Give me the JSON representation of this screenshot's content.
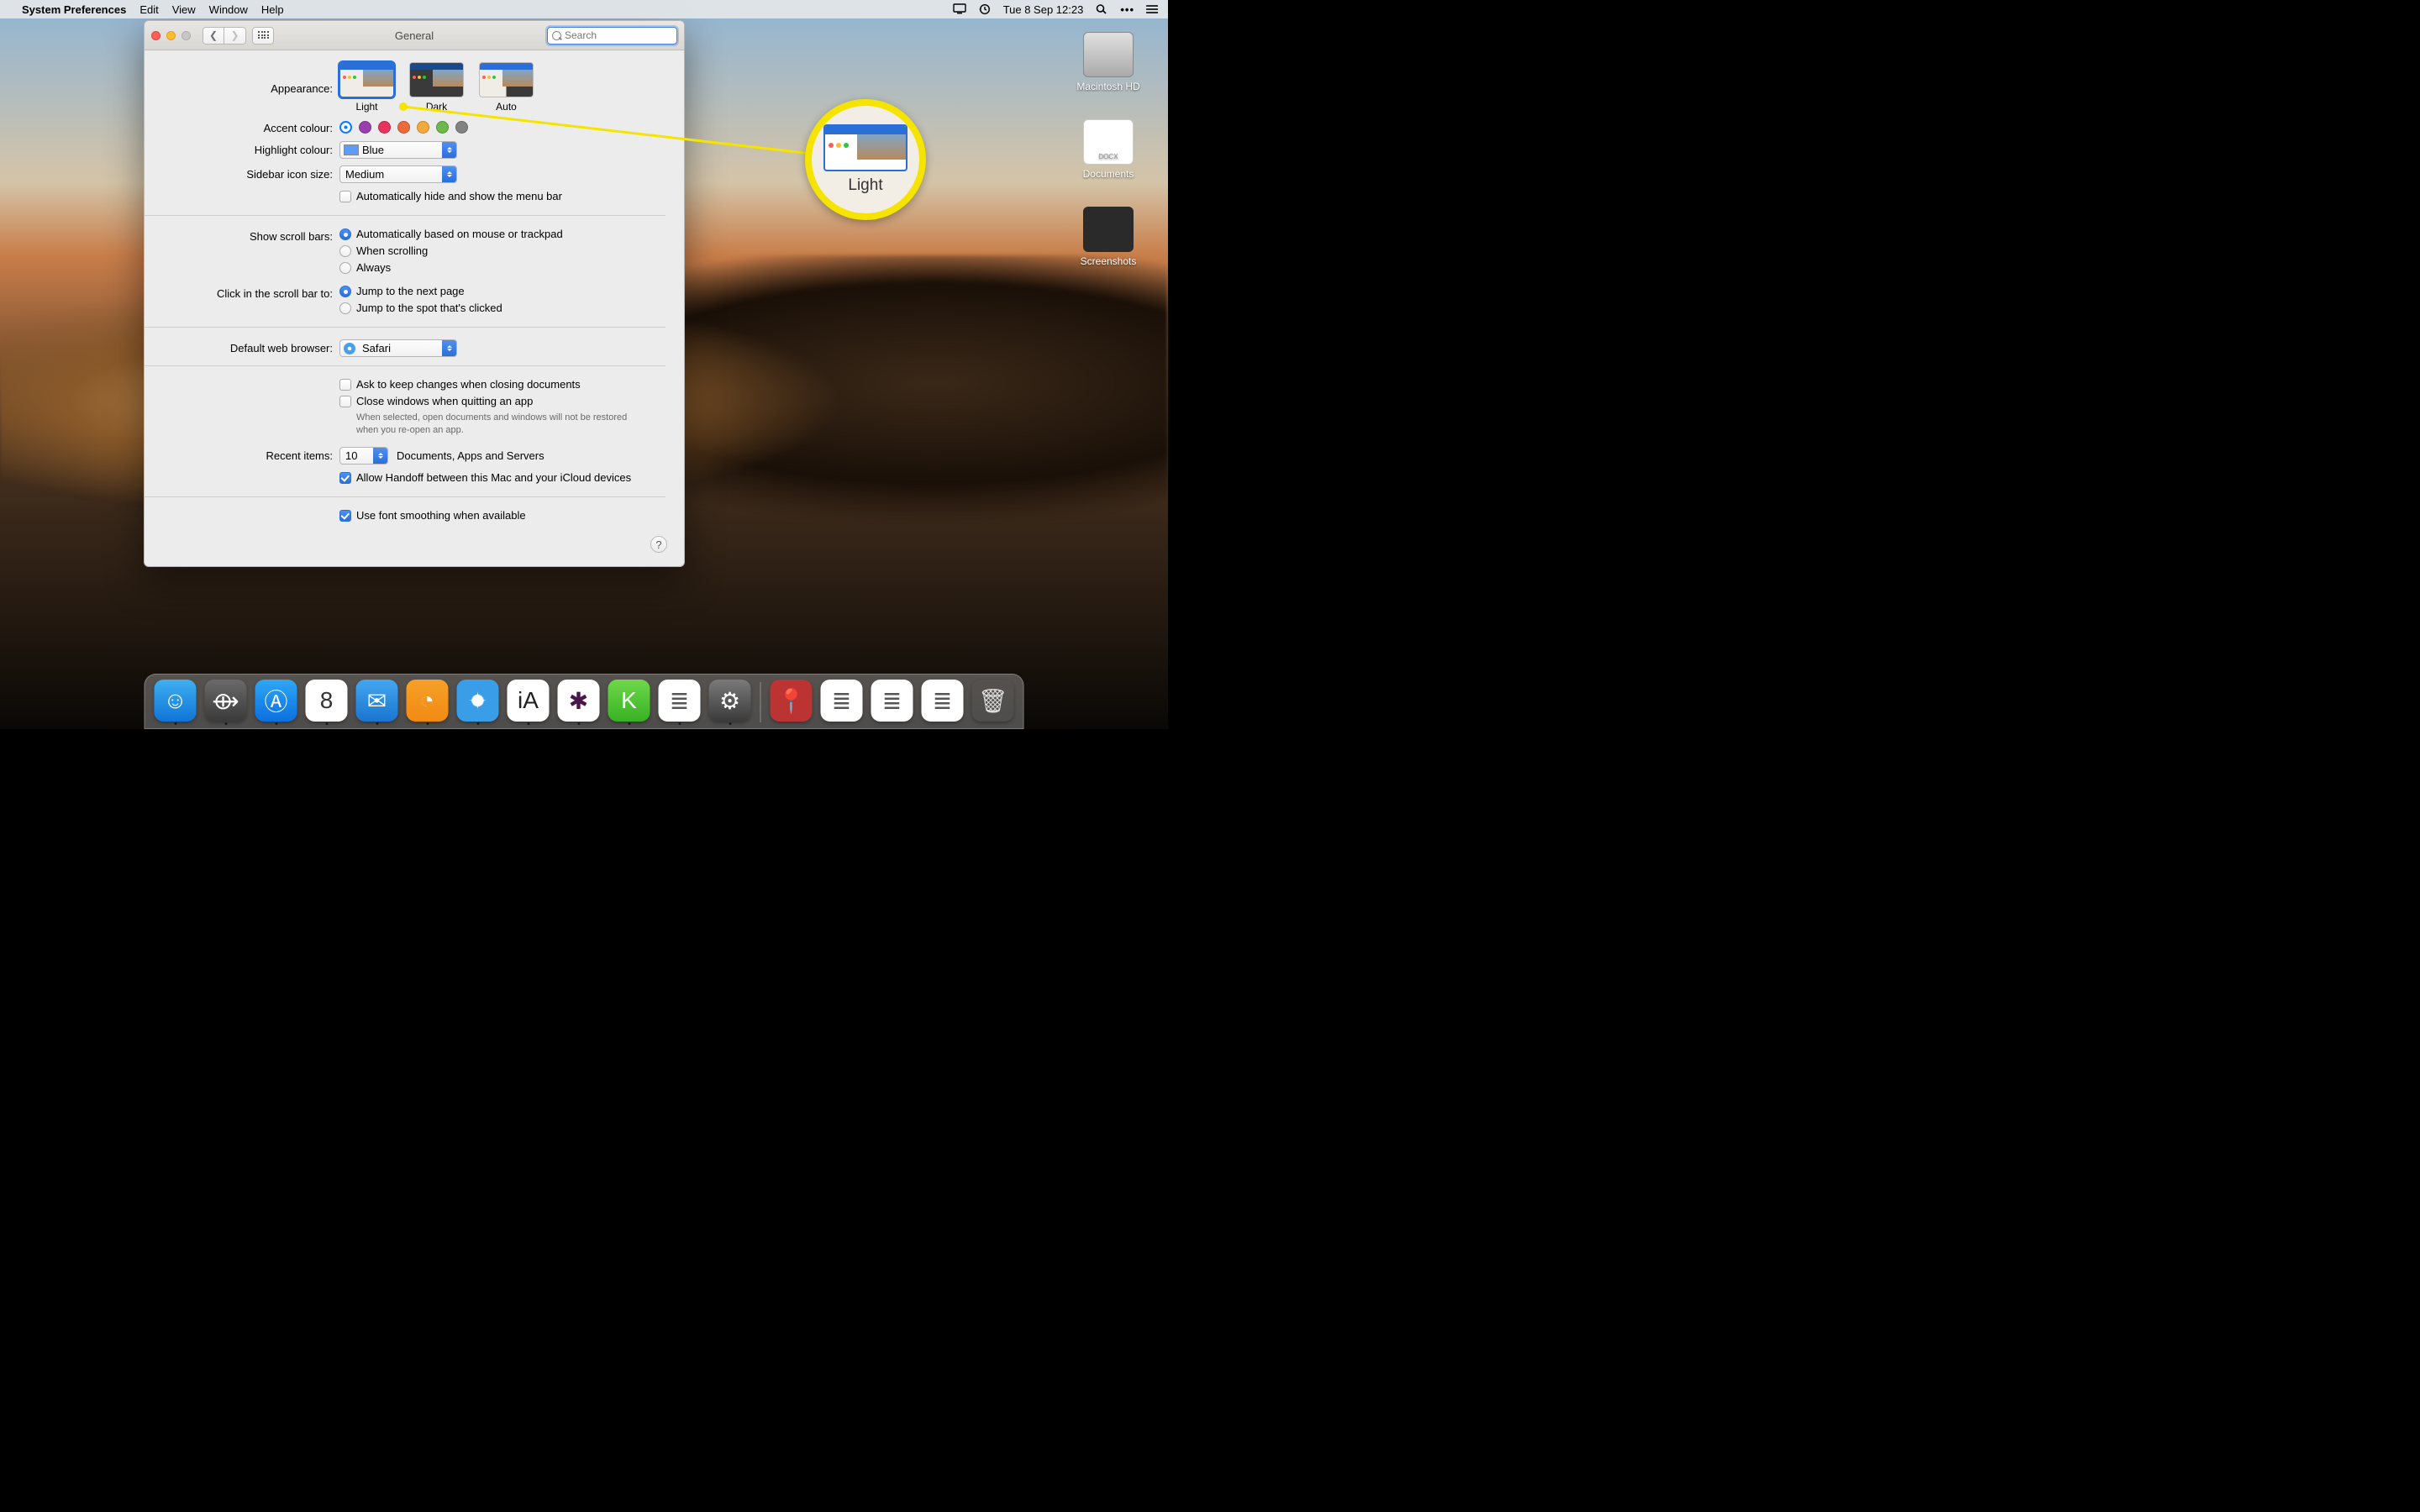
{
  "menubar": {
    "app": "System Preferences",
    "items": [
      "Edit",
      "View",
      "Window",
      "Help"
    ],
    "datetime": "Tue 8 Sep  12:23"
  },
  "desktop_icons": [
    {
      "name": "Macintosh HD",
      "kind": "hd"
    },
    {
      "name": "Documents",
      "kind": "folder",
      "badge": "DOCX"
    },
    {
      "name": "Screenshots",
      "kind": "shots"
    }
  ],
  "window": {
    "title": "General",
    "search_placeholder": "Search"
  },
  "general": {
    "appearance_label": "Appearance:",
    "appearance": [
      {
        "label": "Light",
        "selected": true,
        "kind": "light"
      },
      {
        "label": "Dark",
        "selected": false,
        "kind": "dark"
      },
      {
        "label": "Auto",
        "selected": false,
        "kind": "auto"
      }
    ],
    "accent_label": "Accent colour:",
    "accent_colors": [
      "#0a7aff",
      "#9a3ead",
      "#e7345a",
      "#ef6a3b",
      "#f3a93b",
      "#6cb84b",
      "#828282"
    ],
    "accent_selected_index": 0,
    "highlight_label": "Highlight colour:",
    "highlight_value": "Blue",
    "sidebar_label": "Sidebar icon size:",
    "sidebar_value": "Medium",
    "autohide_label": "Automatically hide and show the menu bar",
    "scroll_label": "Show scroll bars:",
    "scroll_opts": [
      {
        "label": "Automatically based on mouse or trackpad",
        "on": true
      },
      {
        "label": "When scrolling",
        "on": false
      },
      {
        "label": "Always",
        "on": false
      }
    ],
    "click_label": "Click in the scroll bar to:",
    "click_opts": [
      {
        "label": "Jump to the next page",
        "on": true
      },
      {
        "label": "Jump to the spot that's clicked",
        "on": false
      }
    ],
    "browser_label": "Default web browser:",
    "browser_value": "Safari",
    "ask_keep_label": "Ask to keep changes when closing documents",
    "close_windows_label": "Close windows when quitting an app",
    "close_windows_help": "When selected, open documents and windows will not be restored when you re-open an app.",
    "recent_label": "Recent items:",
    "recent_value": "10",
    "recent_suffix": "Documents, Apps and Servers",
    "handoff_label": "Allow Handoff between this Mac and your iCloud devices",
    "font_smoothing_label": "Use font smoothing when available"
  },
  "callout": {
    "label": "Light"
  },
  "dock": [
    {
      "name": "Finder",
      "bg": "linear-gradient(#3fb0f0,#1074d8)",
      "glyph": "☺"
    },
    {
      "name": "Launchpad",
      "bg": "linear-gradient(#6a6a6a,#3a3a3a)",
      "glyph": "⟴"
    },
    {
      "name": "App Store",
      "bg": "linear-gradient(#2fa7f5,#0a6fe0)",
      "glyph": "Ⓐ"
    },
    {
      "name": "Calendar",
      "bg": "#fff",
      "glyph": "8",
      "fg": "#333"
    },
    {
      "name": "Mail",
      "bg": "linear-gradient(#44a6ef,#1975d1)",
      "glyph": "✉"
    },
    {
      "name": "Tot",
      "bg": "linear-gradient(#f6a028,#f18a12)",
      "glyph": "◔"
    },
    {
      "name": "Safari",
      "bg": "radial-gradient(circle,#fff 18%,#3a9de8 22%)",
      "glyph": "✦"
    },
    {
      "name": "iA Writer",
      "bg": "#fff",
      "glyph": "iA",
      "fg": "#222"
    },
    {
      "name": "Slack",
      "bg": "#fff",
      "glyph": "✱",
      "fg": "#4a154b"
    },
    {
      "name": "Emerald",
      "bg": "linear-gradient(#6ed84a,#38b023)",
      "glyph": "K"
    },
    {
      "name": "TextEdit",
      "bg": "#fff",
      "glyph": "≣",
      "fg": "#555"
    },
    {
      "name": "System Preferences",
      "bg": "linear-gradient(#7a7a7a,#3a3a3a)",
      "glyph": "⚙"
    }
  ],
  "dock_right": [
    {
      "name": "Pin",
      "bg": "#b33",
      "glyph": "📍"
    },
    {
      "name": "Doc1",
      "bg": "#fff",
      "glyph": "≣",
      "fg": "#555"
    },
    {
      "name": "Doc2",
      "bg": "#fff",
      "glyph": "≣",
      "fg": "#555"
    },
    {
      "name": "Doc3",
      "bg": "#fff",
      "glyph": "≣",
      "fg": "#555"
    },
    {
      "name": "Trash",
      "bg": "transparent",
      "glyph": "🗑",
      "fg": "#ddd"
    }
  ]
}
